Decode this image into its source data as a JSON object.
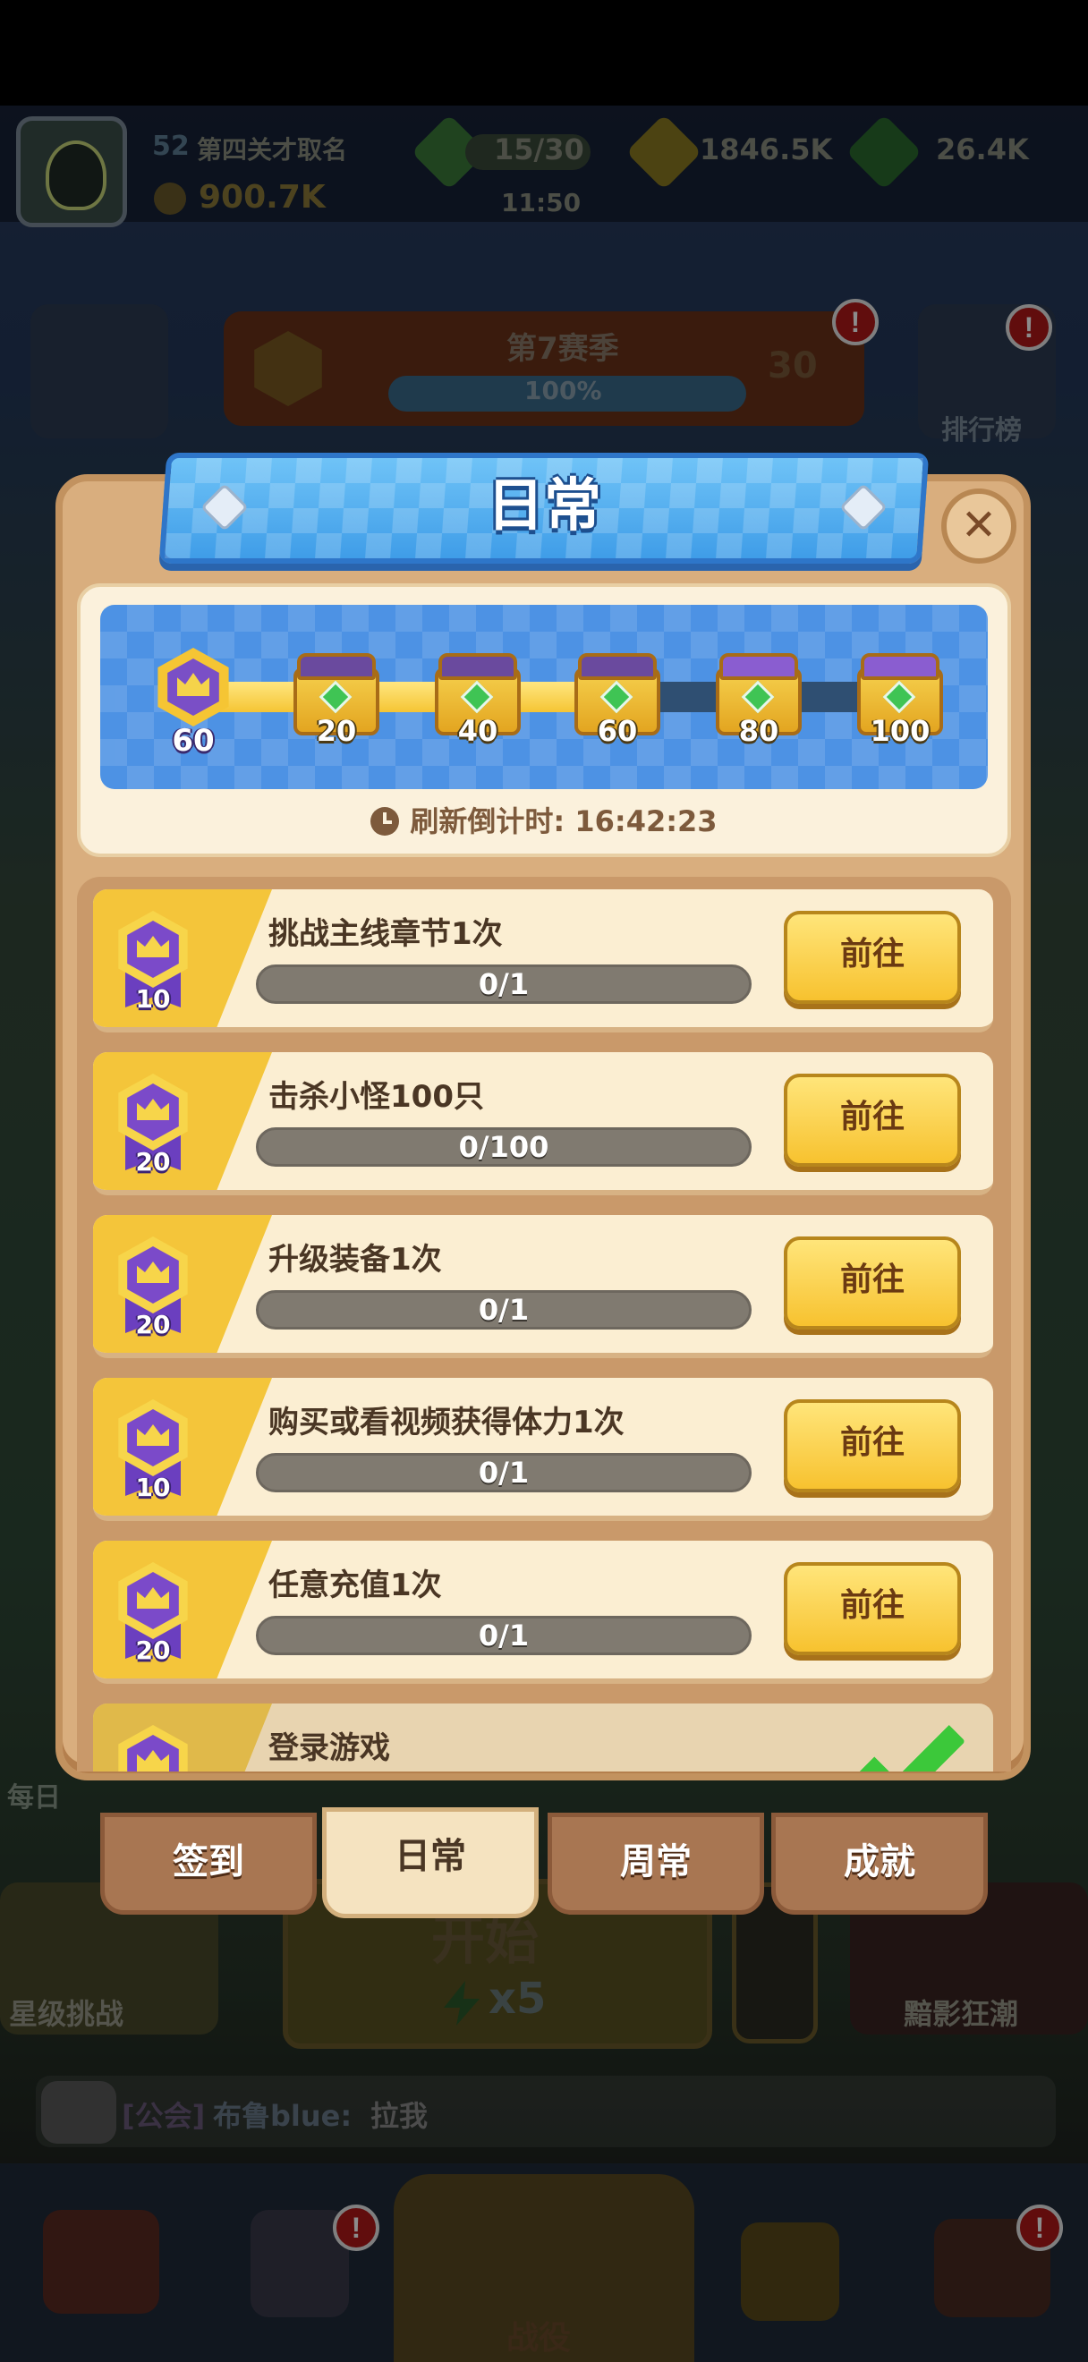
{
  "topbar": {
    "level": "52",
    "player_title": "第四关才取名",
    "power": "900.7K",
    "energy": "15/30",
    "energy_timer": "11:50",
    "gold": "1846.5K",
    "gems": "26.4K"
  },
  "season": {
    "title": "第7赛季",
    "progress_text": "100%",
    "level_badge": "30",
    "ranking_label": "排行榜"
  },
  "background": {
    "star_challenge": "星级挑战",
    "start_label": "开始",
    "energy_cost": "x5",
    "shadow_tide": "黯影狂潮",
    "daily_side": "每日",
    "chat_channel": "[公会]",
    "chat_user": "布鲁blue:",
    "chat_message": "拉我",
    "nav_battle": "战役"
  },
  "dialog": {
    "title": "日常",
    "close_icon": "close-icon",
    "current_points": "60",
    "progress_fraction": 0.6,
    "milestones": [
      {
        "points": "20",
        "state": "reached"
      },
      {
        "points": "40",
        "state": "reached"
      },
      {
        "points": "60",
        "state": "reached"
      },
      {
        "points": "80",
        "state": "locked"
      },
      {
        "points": "100",
        "state": "locked"
      }
    ],
    "refresh_label": "刷新倒计时:",
    "refresh_time": "16:42:23",
    "tasks": [
      {
        "reward": "10",
        "title": "挑战主线章节1次",
        "progress": "0/1",
        "fraction": 0,
        "button": "前往"
      },
      {
        "reward": "20",
        "title": "击杀小怪100只",
        "progress": "0/100",
        "fraction": 0,
        "button": "前往"
      },
      {
        "reward": "20",
        "title": "升级装备1次",
        "progress": "0/1",
        "fraction": 0,
        "button": "前往"
      },
      {
        "reward": "10",
        "title": "购买或看视频获得体力1次",
        "progress": "0/1",
        "fraction": 0,
        "button": "前往"
      },
      {
        "reward": "20",
        "title": "任意充值1次",
        "progress": "0/1",
        "fraction": 0,
        "button": "前往"
      },
      {
        "reward": "",
        "title": "登录游戏",
        "state": "completed"
      }
    ]
  },
  "tabs": [
    {
      "label": "签到",
      "active": false
    },
    {
      "label": "日常",
      "active": true
    },
    {
      "label": "周常",
      "active": false
    },
    {
      "label": "成就",
      "active": false
    }
  ],
  "badges": {
    "alert": "!"
  }
}
